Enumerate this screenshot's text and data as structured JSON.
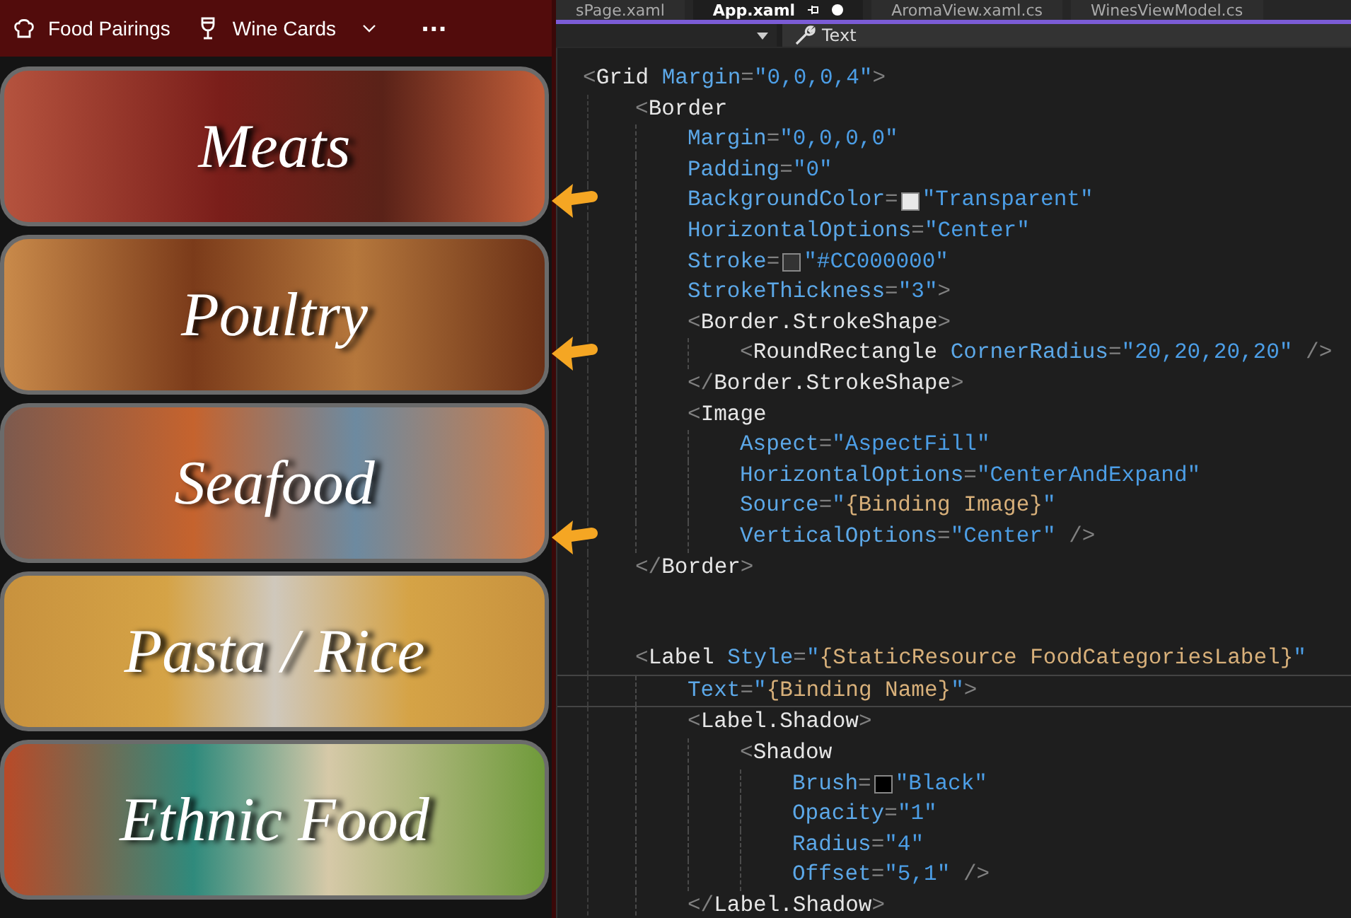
{
  "app_bar": {
    "items": [
      {
        "kind": "chef",
        "label": "Food Pairings"
      },
      {
        "kind": "wine",
        "label": "Wine Cards",
        "dropdown": true
      }
    ],
    "more": "···"
  },
  "categories": [
    {
      "name": "Meats"
    },
    {
      "name": "Poultry"
    },
    {
      "name": "Seafood"
    },
    {
      "name": "Pasta / Rice"
    },
    {
      "name": "Ethnic Food"
    }
  ],
  "editor": {
    "tabs": [
      {
        "label": "sPage.xaml",
        "selected": false
      },
      {
        "label": "App.xaml",
        "selected": true,
        "modified": true
      },
      {
        "label": "AromaView.xaml.cs",
        "selected": false
      },
      {
        "label": "WinesViewModel.cs",
        "selected": false
      }
    ],
    "toolbar": {
      "property": "Text"
    },
    "lines": [
      {
        "kind": "code",
        "text": "<Grid Margin=\"0,0,0,4\">",
        "children": [
          {
            "kind": "code",
            "text": "<Border",
            "children": [
              {
                "kind": "code",
                "text": "Margin=\"0,0,0,0\""
              },
              {
                "kind": "code",
                "text": "Padding=\"0\""
              },
              {
                "kind": "code",
                "text": "BackgroundColor=",
                "color": "#e8e8e8",
                "value": "\"Transparent\"",
                "arrow": true
              },
              {
                "kind": "code",
                "text": "HorizontalOptions=\"Center\""
              },
              {
                "kind": "code",
                "text": "Stroke=",
                "color": "#333333",
                "value": "\"#CC000000\""
              },
              {
                "kind": "code",
                "text": "StrokeThickness=\"3\">"
              },
              {
                "kind": "code",
                "text": "<Border.StrokeShape>",
                "children": [
                  {
                    "kind": "code",
                    "text": "<RoundRectangle CornerRadius=\"20,20,20,20\" />",
                    "arrow": true
                  }
                ]
              },
              {
                "kind": "code",
                "text": "</Border.StrokeShape>"
              },
              {
                "kind": "code",
                "text": "<Image",
                "children": [
                  {
                    "kind": "code",
                    "text": "Aspect=\"AspectFill\""
                  },
                  {
                    "kind": "code",
                    "text": "HorizontalOptions=\"CenterAndExpand\""
                  },
                  {
                    "kind": "code",
                    "text": "Source=\"{Binding Image}\""
                  },
                  {
                    "kind": "code",
                    "text": "VerticalOptions=\"Center\" />",
                    "arrow": true
                  }
                ]
              }
            ]
          },
          {
            "kind": "code",
            "text": "</Border>"
          },
          {
            "kind": "blank"
          },
          {
            "kind": "blank"
          },
          {
            "kind": "code",
            "text": "<Label Style=\"{StaticResource FoodCategoriesLabel}\"",
            "children": [
              {
                "kind": "code",
                "text": "Text=\"{Binding Name}\">",
                "current": true
              },
              {
                "kind": "code",
                "text": "<Label.Shadow>",
                "children": [
                  {
                    "kind": "code",
                    "text": "<Shadow",
                    "children": [
                      {
                        "kind": "code",
                        "text": "Brush=",
                        "color": "#000000",
                        "value": "\"Black\""
                      },
                      {
                        "kind": "code",
                        "text": "Opacity=\"1\""
                      },
                      {
                        "kind": "code",
                        "text": "Radius=\"4\""
                      },
                      {
                        "kind": "code",
                        "text": "Offset=\"5,1\" />"
                      }
                    ]
                  }
                ]
              },
              {
                "kind": "code",
                "text": "</Label.Shadow>"
              }
            ]
          }
        ]
      }
    ]
  }
}
